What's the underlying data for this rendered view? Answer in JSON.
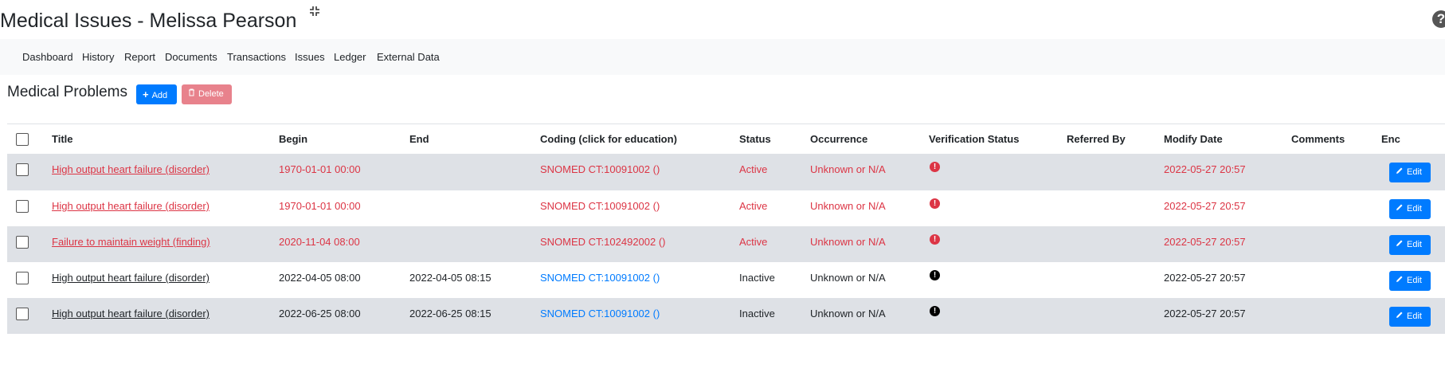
{
  "page": {
    "title": "Medical Issues - Melissa Pearson"
  },
  "icons": {
    "expand": "expand-icon",
    "help": "help-icon",
    "add": "plus-icon",
    "delete": "trash-icon",
    "edit": "pencil-icon",
    "alert": "exclamation-circle-icon"
  },
  "nav": {
    "items": [
      "Dashboard",
      "History",
      "Report",
      "Documents",
      "Transactions",
      "Issues",
      "Ledger",
      "External Data"
    ]
  },
  "section": {
    "title": "Medical Problems",
    "add_label": "Add",
    "delete_label": "Delete"
  },
  "colors": {
    "active": "#dc3545",
    "inactive": "#212529",
    "link": "#007bff",
    "primary": "#007bff"
  },
  "table": {
    "headers": [
      "Title",
      "Begin",
      "End",
      "Coding (click for education)",
      "Status",
      "Occurrence",
      "Verification Status",
      "Referred By",
      "Modify Date",
      "Comments",
      "Enc"
    ],
    "edit_label": "Edit",
    "rows": [
      {
        "title": "High output heart failure (disorder)",
        "begin": "1970-01-01 00:00",
        "end": "",
        "coding": "SNOMED CT:10091002 ()",
        "status": "Active",
        "occurrence": "Unknown or N/A",
        "verification": "",
        "referred_by": "",
        "modify_date": "2022-05-27 20:57",
        "comments": ""
      },
      {
        "title": "High output heart failure (disorder)",
        "begin": "1970-01-01 00:00",
        "end": "",
        "coding": "SNOMED CT:10091002 ()",
        "status": "Active",
        "occurrence": "Unknown or N/A",
        "verification": "",
        "referred_by": "",
        "modify_date": "2022-05-27 20:57",
        "comments": ""
      },
      {
        "title": "Failure to maintain weight (finding)",
        "begin": "2020-11-04 08:00",
        "end": "",
        "coding": "SNOMED CT:102492002 ()",
        "status": "Active",
        "occurrence": "Unknown or N/A",
        "verification": "",
        "referred_by": "",
        "modify_date": "2022-05-27 20:57",
        "comments": ""
      },
      {
        "title": "High output heart failure (disorder)",
        "begin": "2022-04-05 08:00",
        "end": "2022-04-05 08:15",
        "coding": "SNOMED CT:10091002 ()",
        "status": "Inactive",
        "occurrence": "Unknown or N/A",
        "verification": "",
        "referred_by": "",
        "modify_date": "2022-05-27 20:57",
        "comments": ""
      },
      {
        "title": "High output heart failure (disorder)",
        "begin": "2022-06-25 08:00",
        "end": "2022-06-25 08:15",
        "coding": "SNOMED CT:10091002 ()",
        "status": "Inactive",
        "occurrence": "Unknown or N/A",
        "verification": "",
        "referred_by": "",
        "modify_date": "2022-05-27 20:57",
        "comments": ""
      }
    ]
  }
}
